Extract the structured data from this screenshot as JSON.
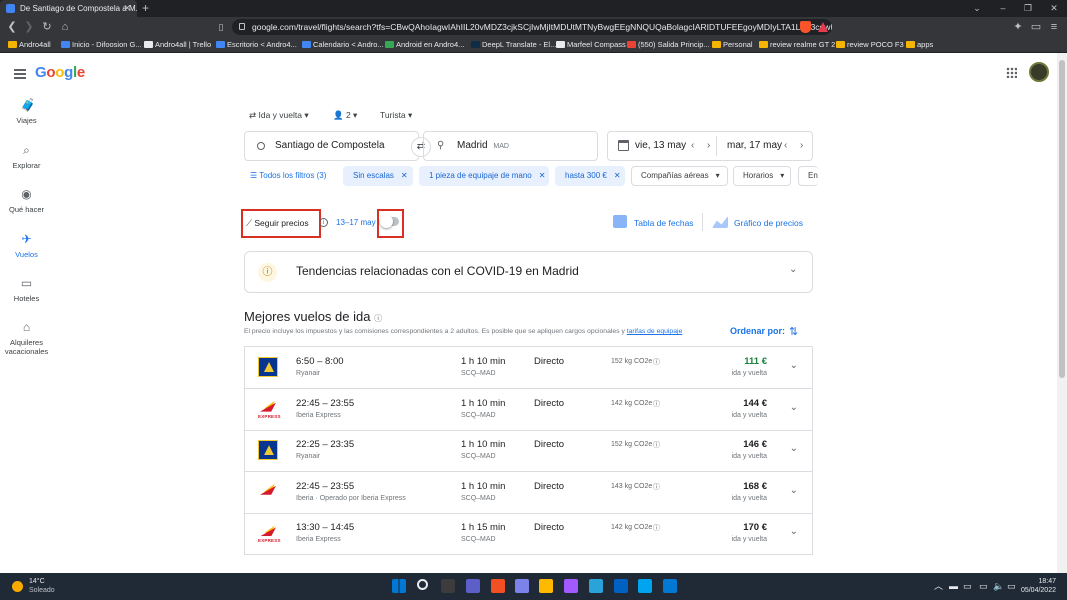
{
  "browser": {
    "tab_title": "De Santiago de Compostela a M...",
    "url": "google.com/travel/flights/search?tfs=CBwQAhoIagwIAhIIL20vMDZ3cjkSCjIwMjItMDUtMTNyBwgEEgNNQUQaBolagcIARIDTUFEEgoyMDIyLTA1LTE3cgwIAh...",
    "bookmarks": [
      "Andro4all",
      "Inicio - Difoosion G...",
      "Andro4all | Trello",
      "Escritorio < Andro4...",
      "Calendario < Andro...",
      "Android en Andro4...",
      "DeepL Translate - El...",
      "Marfeel Compass",
      "(550) Salida Princip...",
      "Personal",
      "review realme GT 2",
      "review POCO F3",
      "apps"
    ],
    "bookmark_colors": [
      "#f4b400",
      "#4285f4",
      "#e8eaed",
      "#4285f4",
      "#4285f4",
      "#34a853",
      "#0f2b46",
      "#e8eaed",
      "#ea4335",
      "#f4b400",
      "#f4b400",
      "#f4b400",
      "#f4b400"
    ]
  },
  "header": {
    "logo_letters": [
      "G",
      "o",
      "o",
      "g",
      "l",
      "e"
    ],
    "logo_colors": [
      "#4285f4",
      "#ea4335",
      "#fbbc04",
      "#4285f4",
      "#34a853",
      "#ea4335"
    ]
  },
  "sidebar": [
    {
      "label": "Viajes",
      "icon": "luggage-icon",
      "glyph": "🧳"
    },
    {
      "label": "Explorar",
      "icon": "explore-icon",
      "glyph": "⌕"
    },
    {
      "label": "Qué hacer",
      "icon": "camera-icon",
      "glyph": "◉"
    },
    {
      "label": "Vuelos",
      "icon": "flight-icon",
      "glyph": "✈",
      "active": true
    },
    {
      "label": "Hoteles",
      "icon": "bed-icon",
      "glyph": "▭"
    },
    {
      "label": "Alquileres vacacionales",
      "icon": "home-icon",
      "glyph": "⌂"
    }
  ],
  "search": {
    "trip_type": "Ida y vuelta",
    "passengers": "2",
    "cabin": "Turista",
    "origin": "Santiago de Compostela",
    "destination": "Madrid",
    "destination_code": "MAD",
    "depart_date": "vie, 13 may",
    "return_date": "mar, 17 may"
  },
  "filters": {
    "all": "Todos los filtros (3)",
    "chips": [
      {
        "label": "Sin escalas",
        "selected": true
      },
      {
        "label": "1 pieza de equipaje de mano",
        "selected": true
      },
      {
        "label": "hasta 300 €",
        "selected": true
      },
      {
        "label": "Compañías aéreas",
        "selected": false
      },
      {
        "label": "Horarios",
        "selected": false
      },
      {
        "label": "En",
        "selected": false
      }
    ]
  },
  "tracking": {
    "label": "Seguir precios",
    "dates": "13–17 may",
    "toggle_on": false,
    "date_grid": "Tabla de fechas",
    "price_graph": "Gráfico de precios"
  },
  "covid_banner": "Tendencias relacionadas con el COVID-19 en Madrid",
  "results": {
    "title": "Mejores vuelos de ida",
    "note": "El precio incluye los impuestos y las comisiones correspondientes a 2 adultos. Es posible que se apliquen cargos opcionales y",
    "note_link": "tarifas de equipaje",
    "sort_label": "Ordenar por:",
    "flights": [
      {
        "times": "6:50 – 8:00",
        "airline": "Ryanair",
        "logo": "ryanair",
        "duration": "1 h 10 min",
        "route": "SCQ–MAD",
        "stops": "Directo",
        "co2": "152 kg CO2e",
        "price": "111 €",
        "price_green": true,
        "price_type": "ida y vuelta"
      },
      {
        "times": "22:45 – 23:55",
        "airline": "Iberia Express",
        "logo": "iberia-express",
        "duration": "1 h 10 min",
        "route": "SCQ–MAD",
        "stops": "Directo",
        "co2": "142 kg CO2e",
        "price": "144 €",
        "price_green": false,
        "price_type": "ida y vuelta"
      },
      {
        "times": "22:25 – 23:35",
        "airline": "Ryanair",
        "logo": "ryanair",
        "duration": "1 h 10 min",
        "route": "SCQ–MAD",
        "stops": "Directo",
        "co2": "152 kg CO2e",
        "price": "146 €",
        "price_green": false,
        "price_type": "ida y vuelta"
      },
      {
        "times": "22:45 – 23:55",
        "airline": "Iberia · Operado por Iberia Express",
        "logo": "iberia",
        "duration": "1 h 10 min",
        "route": "SCQ–MAD",
        "stops": "Directo",
        "co2": "143 kg CO2e",
        "price": "168 €",
        "price_green": false,
        "price_type": "ida y vuelta"
      },
      {
        "times": "13:30 – 14:45",
        "airline": "Iberia Express",
        "logo": "iberia-express",
        "duration": "1 h 15 min",
        "route": "SCQ–MAD",
        "stops": "Directo",
        "co2": "142 kg CO2e",
        "price": "170 €",
        "price_green": false,
        "price_type": "ida y vuelta"
      }
    ]
  },
  "taskbar": {
    "weather_temp": "14°C",
    "weather_desc": "Soleado",
    "time": "18:47",
    "date": "05/04/2022",
    "apps": [
      "#0078d4",
      "#e8eaed",
      "#3c3c3c",
      "#5b5fc7",
      "#f25022",
      "#7b83eb",
      "#ffb900",
      "#a259ff",
      "#2aa4d8",
      "#0061c3",
      "#00a4ef",
      "#0078d4"
    ]
  }
}
